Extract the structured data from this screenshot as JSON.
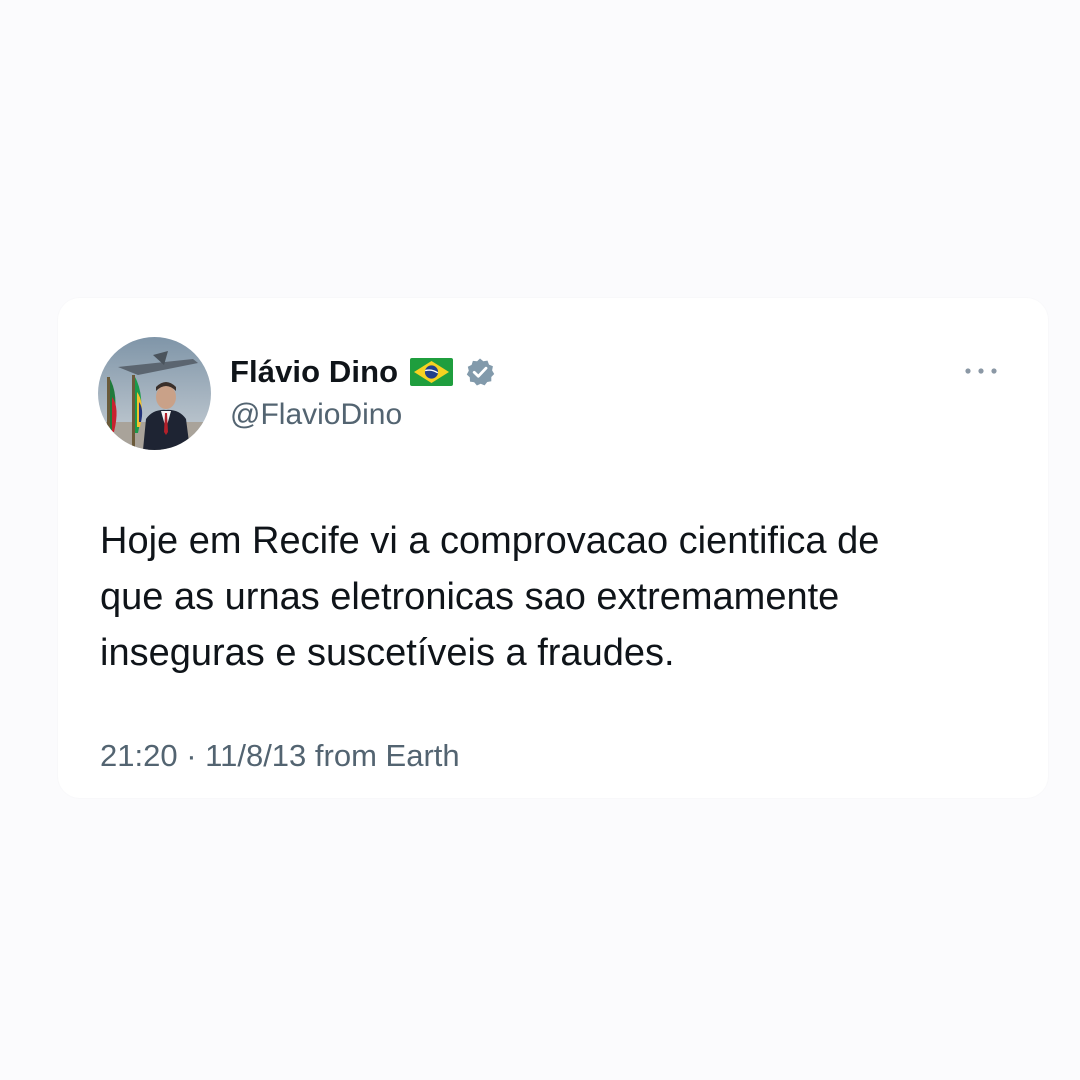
{
  "tweet": {
    "author": {
      "display_name": "Flávio Dino",
      "handle": "@FlavioDino",
      "flag_icon": "brazil-flag-icon",
      "verified_icon": "verified-badge-icon",
      "verified_color": "#829aab"
    },
    "text_lines": [
      "Hoje em Recife vi a comprovacao cientifica de",
      "que as urnas eletronicas sao extremamente",
      "inseguras e suscetíveis a fraudes."
    ],
    "time": "21:20",
    "separator": "·",
    "date": "11/8/13",
    "source": "from Earth",
    "more_icon": "more-options-icon"
  },
  "colors": {
    "background": "#fbfbfd",
    "card": "#ffffff",
    "primary_text": "#0f1419",
    "secondary_text": "#536471"
  }
}
